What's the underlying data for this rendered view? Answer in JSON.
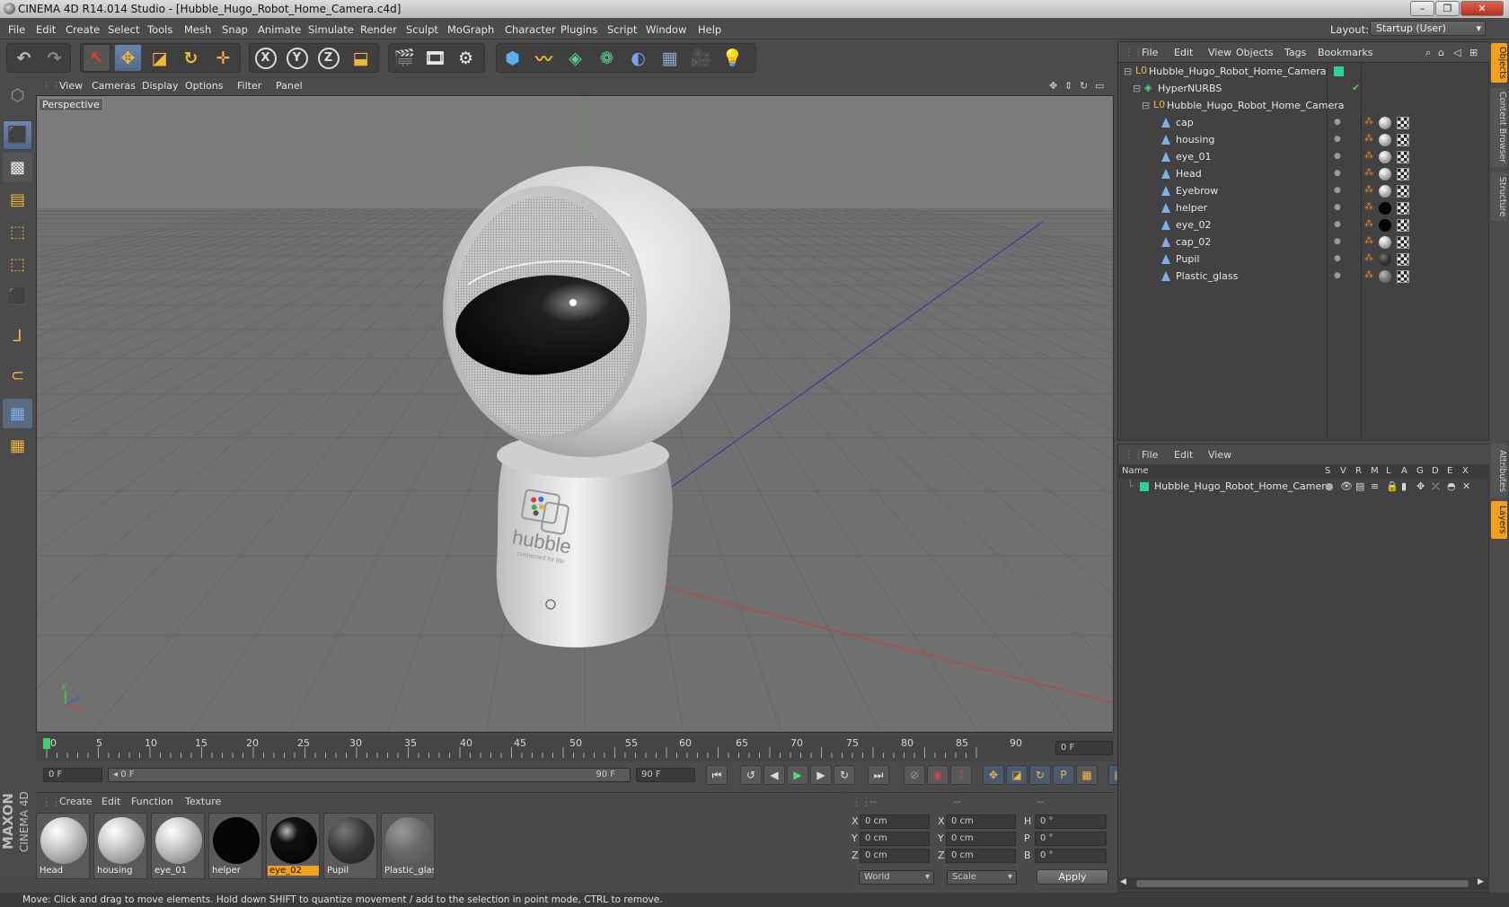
{
  "window": {
    "title": "CINEMA 4D R14.014 Studio - [Hubble_Hugo_Robot_Home_Camera.c4d]",
    "min": "–",
    "max": "❐",
    "close": "✕"
  },
  "menu": [
    "File",
    "Edit",
    "Create",
    "Select",
    "Tools",
    "Mesh",
    "Snap",
    "Animate",
    "Simulate",
    "Render",
    "Sculpt",
    "MoGraph",
    "Character",
    "Plugins",
    "Script",
    "Window",
    "Help"
  ],
  "layout": {
    "label": "Layout:",
    "value": "Startup (User)"
  },
  "toolbar": {
    "x": "X",
    "y": "Y",
    "z": "Z"
  },
  "viewport": {
    "menu": [
      "View",
      "Cameras",
      "Display",
      "Options",
      "Filter",
      "Panel"
    ],
    "label": "Perspective",
    "axes": {
      "x": "x",
      "y": "y",
      "z": "z"
    },
    "logo_text": "hubble",
    "logo_sub": "connected for life"
  },
  "timeline": {
    "ticks": [
      "0",
      "5",
      "10",
      "15",
      "20",
      "25",
      "30",
      "35",
      "40",
      "45",
      "50",
      "55",
      "60",
      "65",
      "70",
      "75",
      "80",
      "85",
      "90"
    ],
    "current": "0 F"
  },
  "transport": {
    "start": "0 F",
    "range_start": "0 F",
    "range_end": "90 F",
    "end": "90 F"
  },
  "materials": {
    "menu": [
      "Create",
      "Edit",
      "Function",
      "Texture"
    ],
    "items": [
      {
        "name": "Head",
        "kind": "white"
      },
      {
        "name": "housing",
        "kind": "white"
      },
      {
        "name": "eye_01",
        "kind": "white"
      },
      {
        "name": "helper",
        "kind": "black"
      },
      {
        "name": "eye_02",
        "kind": "glossy",
        "selected": true
      },
      {
        "name": "Pupil",
        "kind": "dark"
      },
      {
        "name": "Plastic_glass",
        "kind": "glass"
      }
    ]
  },
  "coords": {
    "header": [
      "--",
      "--",
      "--"
    ],
    "rows": [
      {
        "a": "X",
        "av": "0 cm",
        "b": "X",
        "bv": "0 cm",
        "c": "H",
        "cv": "0 °"
      },
      {
        "a": "Y",
        "av": "0 cm",
        "b": "Y",
        "bv": "0 cm",
        "c": "P",
        "cv": "0 °"
      },
      {
        "a": "Z",
        "av": "0 cm",
        "b": "Z",
        "bv": "0 cm",
        "c": "B",
        "cv": "0 °"
      }
    ],
    "world": "World",
    "scale": "Scale",
    "apply": "Apply"
  },
  "objects": {
    "menu": [
      "File",
      "Edit",
      "View",
      "Objects",
      "Tags",
      "Bookmarks"
    ],
    "items": [
      {
        "name": "Hubble_Hugo_Robot_Home_Camera",
        "type": "null",
        "level": 0
      },
      {
        "name": "HyperNURBS",
        "type": "nurbs",
        "level": 1
      },
      {
        "name": "Hubble_Hugo_Robot_Home_Camera",
        "type": "null",
        "level": 2
      },
      {
        "name": "cap",
        "type": "poly",
        "level": 3,
        "mat": "white"
      },
      {
        "name": "housing",
        "type": "poly",
        "level": 3,
        "mat": "white"
      },
      {
        "name": "eye_01",
        "type": "poly",
        "level": 3,
        "mat": "white"
      },
      {
        "name": "Head",
        "type": "poly",
        "level": 3,
        "mat": "white"
      },
      {
        "name": "Eyebrow",
        "type": "poly",
        "level": 3,
        "mat": "white"
      },
      {
        "name": "helper",
        "type": "poly",
        "level": 3,
        "mat": "black"
      },
      {
        "name": "eye_02",
        "type": "poly",
        "level": 3,
        "mat": "black"
      },
      {
        "name": "cap_02",
        "type": "poly",
        "level": 3,
        "mat": "white"
      },
      {
        "name": "Pupil",
        "type": "poly",
        "level": 3,
        "mat": "dark"
      },
      {
        "name": "Plastic_glass",
        "type": "poly",
        "level": 3,
        "mat": "glass"
      }
    ]
  },
  "layers": {
    "menu": [
      "File",
      "Edit",
      "View"
    ],
    "columns": [
      "Name",
      "S",
      "V",
      "R",
      "M",
      "L",
      "A",
      "G",
      "D",
      "E",
      "X"
    ],
    "row": "Hubble_Hugo_Robot_Home_Camera"
  },
  "side_tabs": [
    "Objects",
    "Content Browser",
    "Structure",
    "Attributes",
    "Layers"
  ],
  "status": "Move: Click and drag to move elements. Hold down SHIFT to quantize movement / add to the selection in point mode, CTRL to remove.",
  "brand": {
    "a": "MAXON",
    "b": "CINEMA 4D"
  },
  "colors": {
    "accent": "#f0a030",
    "selected": "#f2a01e",
    "bg": "#4b4b4b"
  }
}
